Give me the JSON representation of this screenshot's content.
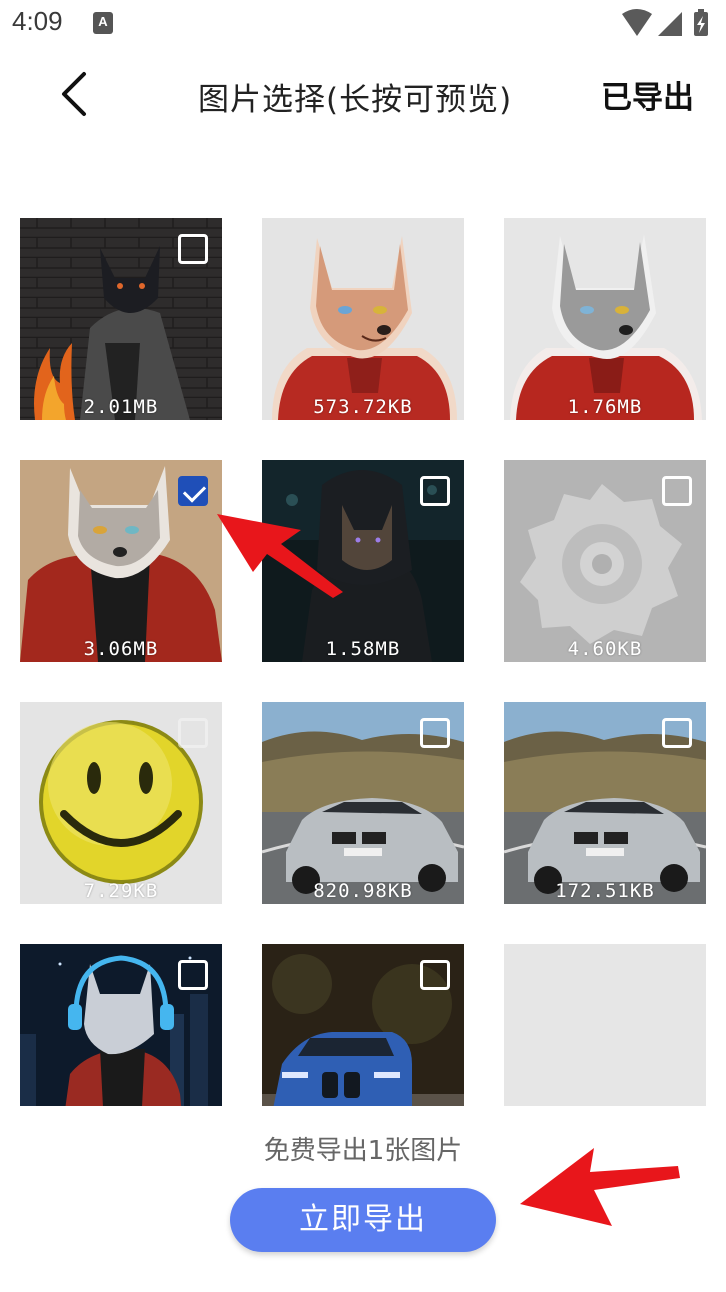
{
  "status_bar": {
    "time": "4:09",
    "notification_icon": "A",
    "icons": [
      "wifi-icon",
      "signal-icon",
      "battery-charging-icon"
    ]
  },
  "header": {
    "title": "图片选择(长按可预览)",
    "right_action": "已导出",
    "back_icon": "chevron-left-icon"
  },
  "images": [
    {
      "size": "2.01MB",
      "checked": false,
      "subject": "dark wolf by fire"
    },
    {
      "size": "573.72KB",
      "checked": false,
      "subject": "tan wolf red hoodie sticker"
    },
    {
      "size": "1.76MB",
      "checked": false,
      "subject": "grey wolf red hoodie sticker"
    },
    {
      "size": "3.06MB",
      "checked": true,
      "subject": "wolf in red jacket"
    },
    {
      "size": "1.58MB",
      "checked": false,
      "subject": "hooded wolf in dark"
    },
    {
      "size": "4.60KB",
      "checked": false,
      "subject": "grey gear settings icon"
    },
    {
      "size": "7.29KB",
      "checked": false,
      "subject": "yellow smiley face"
    },
    {
      "size": "820.98KB",
      "checked": false,
      "subject": "silver bmw car"
    },
    {
      "size": "172.51KB",
      "checked": false,
      "subject": "silver bmw car"
    },
    {
      "size": "",
      "checked": false,
      "subject": "wolf with headphones"
    },
    {
      "size": "",
      "checked": false,
      "subject": "blue bmw car"
    },
    {
      "size": "",
      "checked": false,
      "subject": "empty placeholder"
    }
  ],
  "footer": {
    "hint": "免费导出1张图片",
    "export_label": "立即导出"
  },
  "colors": {
    "accent": "#5a7ef0",
    "checkbox_checked": "#1f4fb8",
    "annotation_arrow": "#e8161b"
  }
}
